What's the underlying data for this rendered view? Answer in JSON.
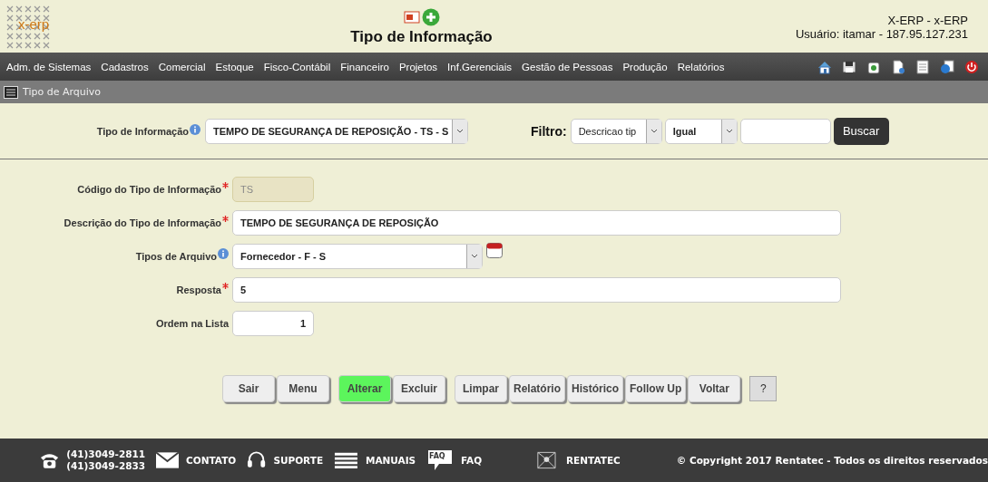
{
  "header": {
    "logo_text": "x-erp",
    "title": "Tipo de Informação",
    "system": "X-ERP - x-ERP",
    "user": "Usuário: itamar - 187.95.127.231"
  },
  "menu": [
    "Adm. de Sistemas",
    "Cadastros",
    "Comercial",
    "Estoque",
    "Fisco-Contábil",
    "Financeiro",
    "Projetos",
    "Inf.Gerenciais",
    "Gestão de Pessoas",
    "Produção",
    "Relatórios"
  ],
  "breadcrumb": "Tipo de Arquivo",
  "search": {
    "label": "Tipo de Informação",
    "value": "TEMPO DE SEGURANÇA DE REPOSIÇÃO - TS - S",
    "filter_label": "Filtro:",
    "filter_field": "Descricao tip",
    "filter_op": "Igual",
    "button": "Buscar"
  },
  "fields": [
    {
      "kind": "text",
      "label": "Código do Tipo de Informação",
      "required": true,
      "info": false,
      "value": "TS",
      "disabled": true
    },
    {
      "kind": "text",
      "label": "Descrição do Tipo de Informação",
      "required": true,
      "info": false,
      "value": "TEMPO DE SEGURANÇA DE REPOSIÇÃO",
      "disabled": false
    },
    {
      "kind": "select",
      "label": "Tipos de Arquivo",
      "required": false,
      "info": true,
      "value": "Fornecedor - F - S",
      "disabled": false
    },
    {
      "kind": "text",
      "label": "Resposta",
      "required": true,
      "info": false,
      "value": "5",
      "disabled": false
    },
    {
      "kind": "number",
      "label": "Ordem na Lista",
      "required": false,
      "info": false,
      "value": "1",
      "disabled": false
    }
  ],
  "button_groups": [
    [
      {
        "label": "Sair",
        "kind": "action",
        "highlighted": false
      },
      {
        "label": "Menu",
        "kind": "action",
        "highlighted": false
      }
    ],
    [
      {
        "label": "Alterar",
        "kind": "action",
        "highlighted": true
      },
      {
        "label": "Excluir",
        "kind": "action",
        "highlighted": false
      }
    ],
    [
      {
        "label": "Limpar",
        "kind": "action",
        "highlighted": false
      },
      {
        "label": "Relatório",
        "kind": "action",
        "highlighted": false
      },
      {
        "label": "Histórico",
        "kind": "action",
        "highlighted": false
      },
      {
        "label": "Follow Up",
        "kind": "action",
        "highlighted": false
      },
      {
        "label": "Voltar",
        "kind": "action",
        "highlighted": false
      }
    ],
    [
      {
        "label": "?",
        "kind": "help",
        "highlighted": false
      }
    ]
  ],
  "footer": {
    "phones": [
      "(41)3049-2811",
      "(41)3049-2833"
    ],
    "contact": "CONTATO",
    "support": "SUPORTE",
    "manuals": "MANUAIS",
    "faq_icon_text": "FAQ",
    "faq": "FAQ",
    "company": "RENTATEC",
    "copyright": "© Copyright 2017 Rentatec - Todos os direitos reservados"
  }
}
